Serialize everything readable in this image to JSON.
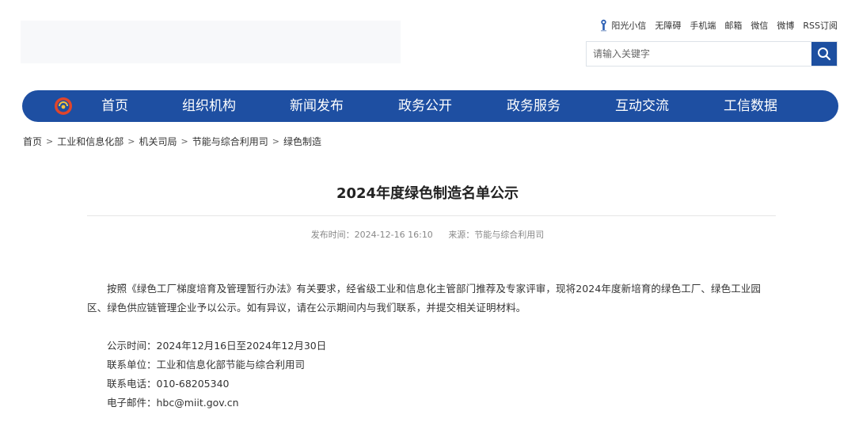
{
  "header": {
    "util_links": [
      "阳光小信",
      "无障碍",
      "手机端",
      "邮箱",
      "微信",
      "微博",
      "RSS订阅"
    ]
  },
  "search": {
    "placeholder": "请输入关键字"
  },
  "nav": {
    "items": [
      "首页",
      "组织机构",
      "新闻发布",
      "政务公开",
      "政务服务",
      "互动交流",
      "工信数据"
    ]
  },
  "breadcrumb": [
    "首页",
    "工业和信息化部",
    "机关司局",
    "节能与综合利用司",
    "绿色制造"
  ],
  "breadcrumb_sep": ">",
  "article": {
    "title": "2024年度绿色制造名单公示",
    "publish_time": "发布时间：2024-12-16 16:10",
    "source": "来源：节能与综合利用司",
    "paragraph": "按照《绿色工厂梯度培育及管理暂行办法》有关要求，经省级工业和信息化主管部门推荐及专家评审，现将2024年度新培育的绿色工厂、绿色工业园区、绿色供应链管理企业予以公示。如有异议，请在公示期间内与我们联系，并提交相关证明材料。",
    "info_lines": [
      "公示时间：2024年12月16日至2024年12月30日",
      "联系单位：工业和信息化部节能与综合利用司",
      "联系电话：010-68205340",
      "电子邮件：hbc@miit.gov.cn"
    ]
  },
  "colors": {
    "nav_bg": "#1e4fa2",
    "search_btn": "#1d4fa0"
  }
}
